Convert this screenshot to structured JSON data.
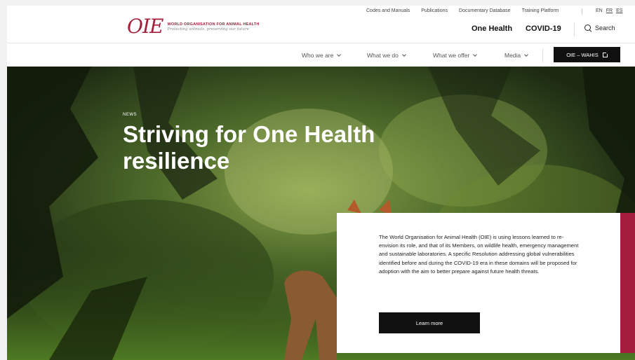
{
  "brand": {
    "logo_mark": "OIE",
    "title": "WORLD ORGANISATION FOR ANIMAL HEALTH",
    "tagline": "Protecting animals, preserving our future"
  },
  "utility_nav": {
    "items": [
      "Codes and Manuals",
      "Publications",
      "Documentary Database",
      "Training Platform"
    ],
    "languages": [
      "EN",
      "FR",
      "ES"
    ]
  },
  "header_links": {
    "one_health": "One Health",
    "covid": "COVID-19",
    "search": "Search"
  },
  "main_nav": {
    "items": [
      "Who we are",
      "What we do",
      "What we offer",
      "Media"
    ],
    "cta": "OIE – WAHIS"
  },
  "hero": {
    "kicker": "NEWS",
    "title": "Striving for One Health resilience",
    "body": "The World Organisation for Animal Health (OIE) is using lessons learned to re-envision its role, and that of its Members, on wildlife health, emergency management and sustainable laboratories. A specific Resolution addressing global vulnerabilities identified before and during the COVID-19 era in these domains will be proposed for adoption with the aim to better prepare against future health threats.",
    "button": "Learn more"
  },
  "colors": {
    "brand": "#a3203b",
    "accent_bar": "#a31c3d",
    "button": "#111111"
  }
}
